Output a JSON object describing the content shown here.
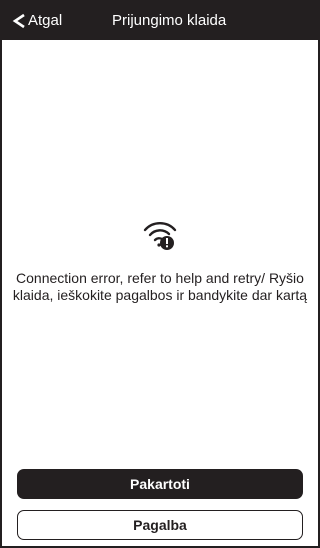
{
  "header": {
    "back_label": "Atgal",
    "title": "Prijungimo klaida"
  },
  "icons": {
    "back": "chevron-left-icon",
    "status": "wifi-error-icon"
  },
  "message": {
    "text": "Connection error, refer to help and retry/  Ryšio klaida, ieškokite pagalbos ir bandykite dar kartą"
  },
  "buttons": {
    "retry_label": "Pakartoti",
    "help_label": "Pagalba"
  },
  "colors": {
    "dark": "#231f20",
    "background": "#ffffff"
  }
}
